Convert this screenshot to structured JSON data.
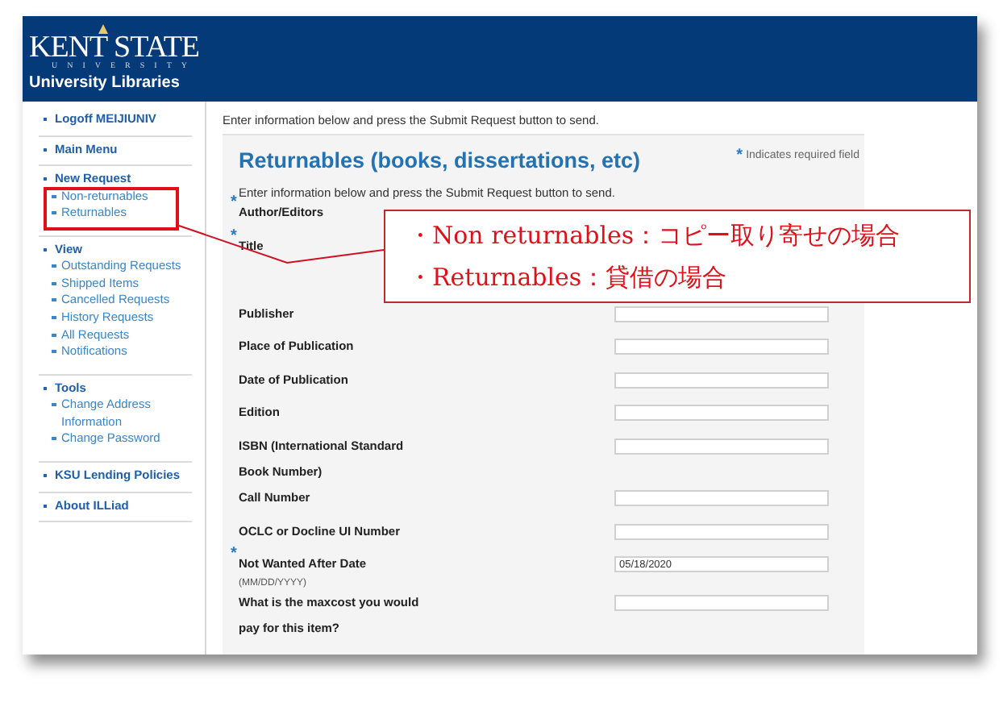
{
  "header": {
    "logo_name": "KENT STATE",
    "logo_sub": "UNIVERSITY",
    "site_title": "University Libraries"
  },
  "sidebar": {
    "groups": [
      {
        "label": "Logoff MEIJIUNIV"
      },
      {
        "label": "Main Menu"
      },
      {
        "label": "New Request",
        "children": [
          "Non-returnables",
          "Returnables"
        ]
      },
      {
        "label": "View",
        "children": [
          "Outstanding Requests",
          "Shipped Items",
          "Cancelled Requests",
          "History Requests",
          "All Requests",
          "Notifications"
        ]
      },
      {
        "label": "Tools",
        "children": [
          "Change Address Information",
          "Change Password"
        ]
      },
      {
        "label": "KSU Lending Policies"
      },
      {
        "label": "About ILLiad"
      }
    ]
  },
  "main": {
    "intro": "Enter information below and press the Submit Request button to send.",
    "form": {
      "title": "Returnables (books, dissertations, etc)",
      "required_mark": "*",
      "required_note": "Indicates required field",
      "intro": "Enter information below and press the Submit Request button to send.",
      "fields": [
        {
          "label": "Author/Editors",
          "required": true,
          "kind": "covered"
        },
        {
          "label": "Title",
          "required": true,
          "kind": "covered"
        },
        {
          "label": "Publisher",
          "required": false,
          "kind": "input"
        },
        {
          "label": "Place of Publication",
          "required": false,
          "kind": "input"
        },
        {
          "label": "Date of Publication",
          "required": false,
          "kind": "input"
        },
        {
          "label": "Edition",
          "required": false,
          "kind": "input"
        },
        {
          "label": "ISBN (International Standard Book Number)",
          "required": false,
          "kind": "input"
        },
        {
          "label": "Call Number",
          "required": false,
          "kind": "input"
        },
        {
          "label": "OCLC or Docline UI Number",
          "required": false,
          "kind": "input"
        },
        {
          "label": "Not Wanted After Date",
          "hint": "(MM/DD/YYYY)",
          "required": true,
          "kind": "input",
          "value": "05/18/2020"
        },
        {
          "label": "What is the maxcost you would pay for this item?",
          "required": false,
          "kind": "input"
        }
      ]
    }
  },
  "annotation": {
    "lines": [
      "・Non returnables：コピー取り寄せの場合",
      "・Returnables：貸借の場合"
    ]
  }
}
